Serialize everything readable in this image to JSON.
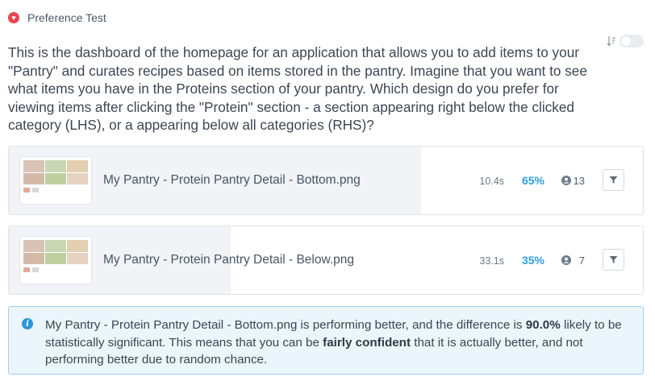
{
  "header": {
    "label": "Preference Test",
    "icon": "heart-icon",
    "accent": "#e8464f"
  },
  "controls": {
    "sort_icon": "sort-descending-icon",
    "toggle_state": "off"
  },
  "question": "This is the dashboard of the homepage for an application that allows you to add items to your \"Pantry\" and curates recipes based on items stored in the pantry. Imagine that you want to see what items you have in the Proteins section of your pantry. Which design do you prefer for viewing items after clicking the \"Protein\" section - a section appearing right below the clicked category (LHS), or a appearing below all categories (RHS)?",
  "results": [
    {
      "name": "My Pantry - Protein Pantry Detail - Bottom.png",
      "time": "10.4s",
      "percent": "65%",
      "share": 0.65,
      "respondents": "13"
    },
    {
      "name": "My Pantry - Protein Pantry Detail - Below.png",
      "time": "33.1s",
      "percent": "35%",
      "share": 0.35,
      "respondents": "7"
    }
  ],
  "info": {
    "part1": "My Pantry - Protein Pantry Detail - Bottom.png is performing better, and the difference is ",
    "difference": "90.0%",
    "part2": " likely to be statistically significant. This means that you can be ",
    "confidence": "fairly confident",
    "part3": " that it is actually better, and not performing better due to random chance."
  },
  "colors": {
    "percent": "#2d9ee0",
    "fill": "#f1f3f6",
    "info_bg": "#eaf5fc",
    "info_border": "#9fd0ec"
  }
}
